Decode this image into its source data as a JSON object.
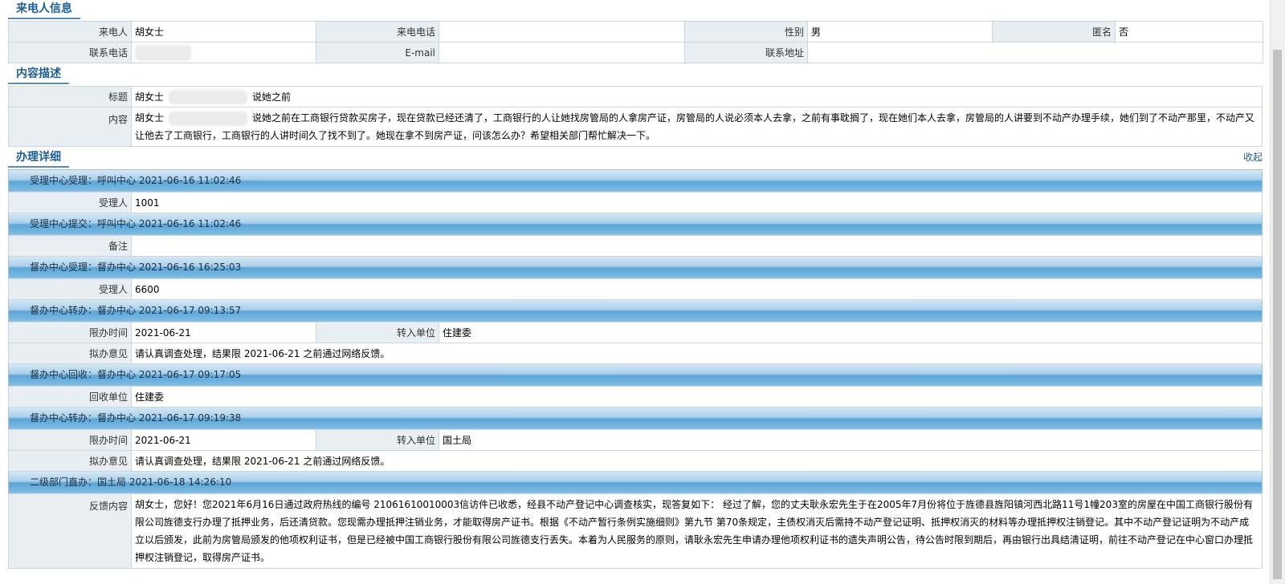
{
  "caller_section": {
    "title": "来电人信息",
    "row1": [
      {
        "label": "来电人",
        "value": "胡女士"
      },
      {
        "label": "来电电话",
        "value": ""
      },
      {
        "label": "性别",
        "value": "男"
      },
      {
        "label": "匿名",
        "value": "否"
      }
    ],
    "row2": [
      {
        "label": "联系电话",
        "value": ""
      },
      {
        "label": "E-mail",
        "value": ""
      },
      {
        "label": "联系地址",
        "value": ""
      }
    ]
  },
  "content_section": {
    "title": "内容描述",
    "subject_label": "标题",
    "subject_value_a": "胡女士",
    "subject_value_b": "说她之前",
    "content_label": "内容",
    "content_value_a": "胡女士",
    "content_value_b": "说她之前在工商银行贷款买房子，现在贷款已经还清了，工商银行的人让她找房管局的人拿房产证，房管局的人说必须本人去拿，之前有事耽搁了，现在她们本人去拿，房管局的人讲要到不动产办理手续，她们到了不动产那里，不动产又让他去了工商银行，工商银行的人讲时间久了找不到了。她现在拿不到房产证，问该怎么办？希望相关部门帮忙解决一下。"
  },
  "detail_section": {
    "title": "办理详细",
    "collapse_label": "收起",
    "steps": [
      {
        "header": "受理中心受理：呼叫中心 2021-06-16 11:02:46"
      },
      {
        "header": "受理中心提交：呼叫中心 2021-06-16 11:02:46"
      },
      {
        "header": "督办中心受理：督办中心 2021-06-16 16:25:03"
      },
      {
        "header": "督办中心转办：督办中心 2021-06-17 09:13:57"
      },
      {
        "header": "督办中心回收：督办中心 2021-06-17 09:17:05"
      },
      {
        "header": "督办中心转办：督办中心 2021-06-17 09:19:38"
      },
      {
        "header": "二级部门直办：国土局 2021-06-18 14:26:10"
      }
    ],
    "step1": {
      "label": "受理人",
      "value": "1001"
    },
    "step2": {
      "label": "备注",
      "value": ""
    },
    "step3": {
      "label": "受理人",
      "value": "6600"
    },
    "step4": {
      "deadline_label": "限办时间",
      "deadline_value": "2021-06-21",
      "unit_label": "转入单位",
      "unit_value": "住建委",
      "opinion_label": "拟办意见",
      "opinion_value": "请认真调查处理，结果限 2021-06-21 之前通过网络反馈。"
    },
    "step5": {
      "label": "回收单位",
      "value": "住建委"
    },
    "step6": {
      "deadline_label": "限办时间",
      "deadline_value": "2021-06-21",
      "unit_label": "转入单位",
      "unit_value": "国土局",
      "opinion_label": "拟办意见",
      "opinion_value": "请认真调查处理，结果限 2021-06-21 之前通过网络反馈。"
    },
    "step7": {
      "label": "反馈内容",
      "value": "胡女士，您好！您2021年6月16日通过政府热线的编号 21061610010003信访件已收悉，经县不动产登记中心调查核实，现答复如下： 经过了解，您的丈夫耿永宏先生于在2005年7月份将位于旌德县旌阳镇河西北路11号1幢203室的房屋在中国工商银行股份有限公司旌德支行办理了抵押业务，后还清贷款。您现需办理抵押注销业务，才能取得房产证书。根据《不动产暂行条例实施细则》第九节 第70条规定，主债权消灭后需持不动产登记证明、抵押权消灭的材料等办理抵押权注销登记。其中不动产登记证明为不动产成立以后颁发，此前为房管局颁发的他项权利证书，但是已经被中国工商银行股份有限公司旌德支行丢失。本着为人民服务的原则，请耿永宏先生申请办理他项权利证书的遗失声明公告，待公告时限到期后，再由银行出具结清证明，前往不动产登记在中心窗口办理抵押权注销登记，取得房产证书。"
    }
  }
}
